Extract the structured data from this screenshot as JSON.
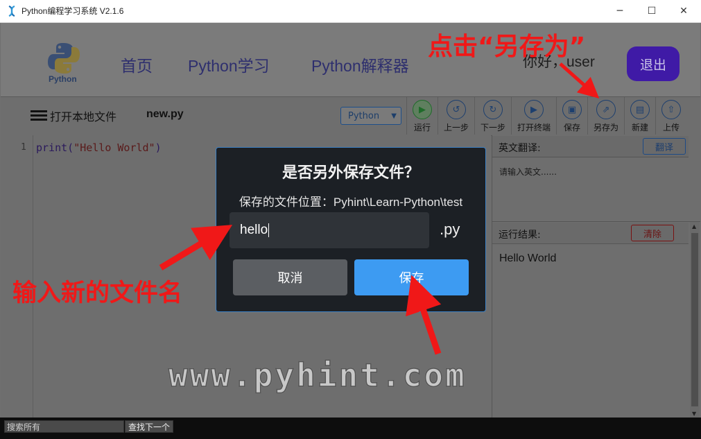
{
  "window": {
    "title": "Python编程学习系统 V2.1.6",
    "controls": [
      "─",
      "☐",
      "✕"
    ]
  },
  "header": {
    "logo_text": "Python",
    "nav": [
      "首页",
      "Python学习",
      "Python解释器"
    ],
    "greeting": "你好，user",
    "logout_label": "退出"
  },
  "toolbar": {
    "open_local_label": "打开本地文件",
    "filename": "new.py",
    "language": "Python",
    "tools": [
      {
        "label": "运行",
        "icon": "run-icon"
      },
      {
        "label": "上一步",
        "icon": "undo-icon"
      },
      {
        "label": "下一步",
        "icon": "redo-icon"
      },
      {
        "label": "打开终端",
        "icon": "terminal-icon"
      },
      {
        "label": "保存",
        "icon": "save-icon"
      },
      {
        "label": "另存为",
        "icon": "save-as-icon"
      },
      {
        "label": "新建",
        "icon": "new-file-icon"
      },
      {
        "label": "上传",
        "icon": "upload-icon"
      }
    ]
  },
  "editor": {
    "line_number": "1",
    "code": {
      "fn": "print(",
      "str": "\"Hello World\"",
      "close": ")"
    }
  },
  "translate_panel": {
    "title": "英文翻译:",
    "button": "翻译",
    "placeholder": "请输入英文......"
  },
  "result_panel": {
    "title": "运行结果:",
    "button": "清除",
    "output": "Hello World"
  },
  "statusbar": {
    "search_placeholder": "搜索所有",
    "find_next": "查找下一个"
  },
  "dialog": {
    "title": "是否另外保存文件？",
    "path_label": "保存的文件位置：Pyhint\\Learn-Python\\test",
    "input_value": "hello",
    "extension": ".py",
    "cancel_label": "取消",
    "save_label": "保存"
  },
  "annotations": {
    "save_as_hint": "点击“另存为”",
    "new_name_hint": "输入新的文件名",
    "watermark": "www.pyhint.com"
  },
  "colors": {
    "annotation": "#f01818",
    "dialog_bg": "#1c2025",
    "save_button": "#3d9bf2",
    "logout_button": "#3f1aa6"
  }
}
